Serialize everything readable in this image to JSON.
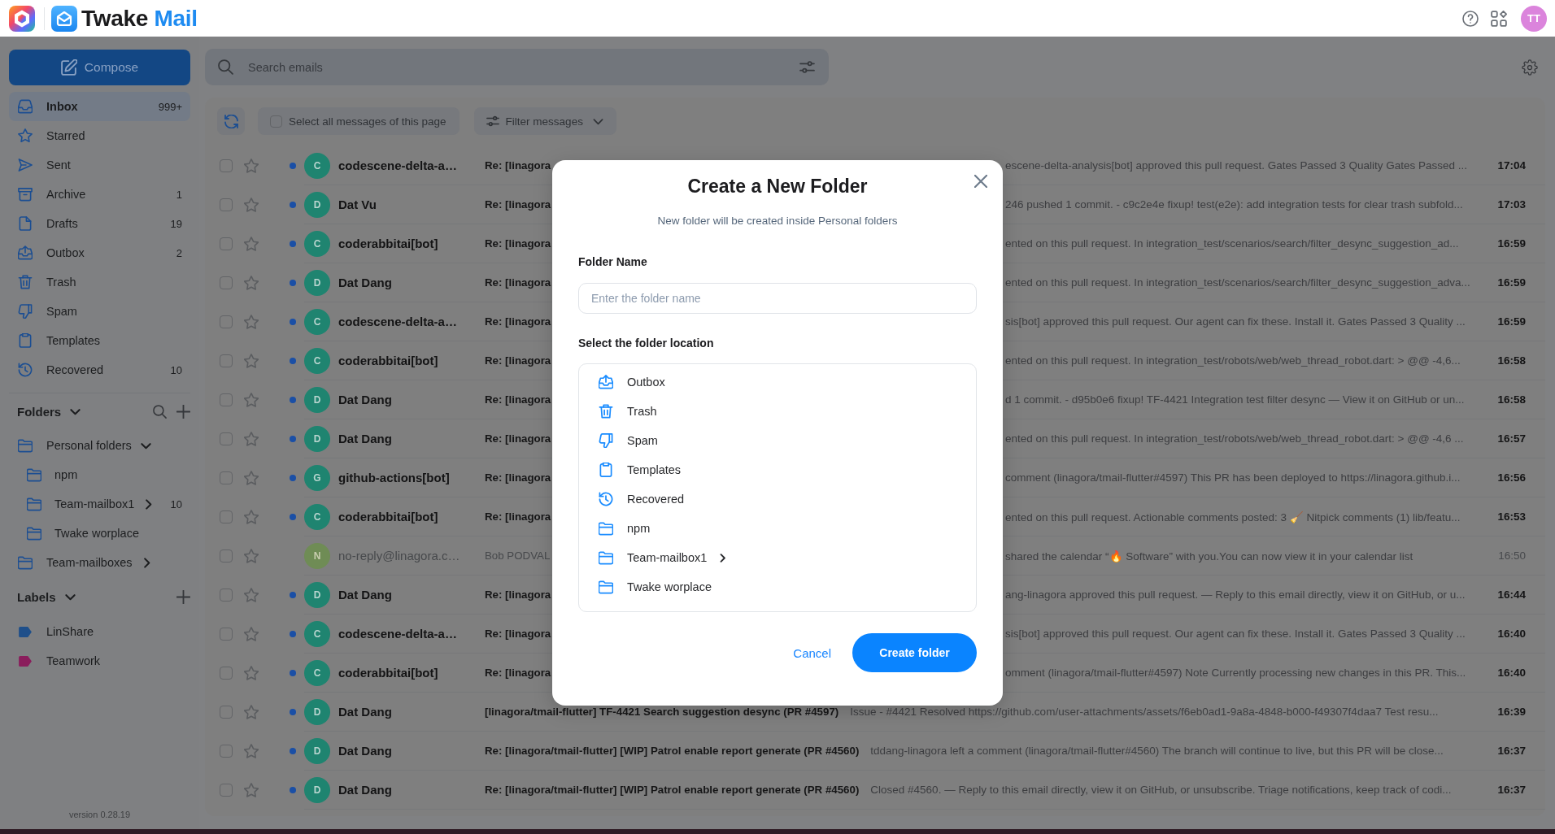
{
  "header": {
    "brand": "Twake",
    "product": "Mail",
    "user_initials": "TT"
  },
  "compose_button": "Compose",
  "mailboxes": [
    {
      "name": "Inbox",
      "kind": "inbox",
      "count": "999+",
      "selected": true
    },
    {
      "name": "Starred",
      "kind": "starred",
      "selected": false
    },
    {
      "name": "Sent",
      "kind": "sent",
      "selected": false
    },
    {
      "name": "Archive",
      "kind": "archive",
      "count": "1",
      "selected": false
    },
    {
      "name": "Drafts",
      "kind": "drafts",
      "count": "19",
      "selected": false
    },
    {
      "name": "Outbox",
      "kind": "outbox",
      "count": "2",
      "selected": false
    },
    {
      "name": "Trash",
      "kind": "trash",
      "selected": false
    },
    {
      "name": "Spam",
      "kind": "spam",
      "selected": false
    },
    {
      "name": "Templates",
      "kind": "templates",
      "selected": false
    },
    {
      "name": "Recovered",
      "kind": "recovered",
      "count": "10",
      "selected": false
    }
  ],
  "folders": {
    "title": "Folders",
    "expanded": true,
    "items": [
      {
        "name": "Personal folders",
        "expanded": true,
        "selected": false,
        "children": [
          {
            "name": "npm",
            "selected": false
          },
          {
            "name": "Team-mailbox1",
            "expanded": false,
            "count": "10",
            "selected": false
          },
          {
            "name": "Twake worplace",
            "selected": false
          }
        ]
      },
      {
        "name": "Team-mailboxes",
        "expanded": false,
        "selected": false
      }
    ]
  },
  "labels": {
    "title": "Labels",
    "expanded": true,
    "items": [
      {
        "name": "LinShare",
        "color": "#1f4f8a",
        "selected": false
      },
      {
        "name": "Teamwork",
        "color": "#8a1d5c",
        "selected": false
      }
    ]
  },
  "version": "version 0.28.19",
  "search": {
    "placeholder": "Search emails"
  },
  "toolbar": {
    "select_all": {
      "label": "Select all messages of this page",
      "checked": false
    },
    "filter": {
      "label": "Filter messages"
    }
  },
  "emails": [
    {
      "sender": "codescene-delta-a…",
      "avatar_letter": "C",
      "color": "#1f8470",
      "unread": true,
      "checked": false,
      "starred": false,
      "subject": "Re: [linagora",
      "preview": "escene-delta-analysis[bot] approved this pull request. Gates Passed 3 Quality Gates Passed ...",
      "time": "17:04"
    },
    {
      "sender": "Dat Vu",
      "avatar_letter": "D",
      "color": "#1f8470",
      "unread": true,
      "checked": false,
      "starred": false,
      "subject": "Re: [linagora",
      "preview": "246 pushed 1 commit. - c9c2e4e fixup! test(e2e): add integration tests for clear trash subfold...",
      "time": "17:03"
    },
    {
      "sender": "coderabbitai[bot]",
      "avatar_letter": "C",
      "color": "#1f8470",
      "unread": true,
      "checked": false,
      "starred": false,
      "subject": "Re: [linagora",
      "preview": "ented on this pull request. In integration_test/scenarios/search/filter_desync_suggestion_ad...",
      "time": "16:59"
    },
    {
      "sender": "Dat Dang",
      "avatar_letter": "D",
      "color": "#1f8470",
      "unread": true,
      "checked": false,
      "starred": false,
      "subject": "Re: [linagora",
      "preview": "ented on this pull request. In integration_test/scenarios/search/filter_desync_suggestion_adva...",
      "time": "16:59"
    },
    {
      "sender": "codescene-delta-a…",
      "avatar_letter": "C",
      "color": "#1f8470",
      "unread": true,
      "checked": false,
      "starred": false,
      "subject": "Re: [linagora",
      "preview": "sis[bot] approved this pull request. Our agent can fix these. Install it. Gates Passed 3 Quality ...",
      "time": "16:59"
    },
    {
      "sender": "coderabbitai[bot]",
      "avatar_letter": "C",
      "color": "#1f8470",
      "unread": true,
      "checked": false,
      "starred": false,
      "subject": "Re: [linagora",
      "preview": "ented on this pull request. In integration_test/robots/web/web_thread_robot.dart: > @@ -4,6...",
      "time": "16:58"
    },
    {
      "sender": "Dat Dang",
      "avatar_letter": "D",
      "color": "#1f8470",
      "unread": true,
      "checked": false,
      "starred": false,
      "subject": "Re: [linagora",
      "preview": "d 1 commit. - d95b0e6 fixup! TF-4421 Integration test filter desync — View it on GitHub or un...",
      "time": "16:58"
    },
    {
      "sender": "Dat Dang",
      "avatar_letter": "D",
      "color": "#1f8470",
      "unread": true,
      "checked": false,
      "starred": false,
      "subject": "Re: [linagora",
      "preview": "ented on this pull request. In integration_test/robots/web/web_thread_robot.dart: > @@ -4,6 ...",
      "time": "16:57"
    },
    {
      "sender": "github-actions[bot]",
      "avatar_letter": "G",
      "color": "#1f8470",
      "unread": true,
      "checked": false,
      "starred": false,
      "subject": "Re: [linagora",
      "preview": "comment (linagora/tmail-flutter#4597) This PR has been deployed to https://linagora.github.i...",
      "time": "16:56"
    },
    {
      "sender": "coderabbitai[bot]",
      "avatar_letter": "C",
      "color": "#1f8470",
      "unread": true,
      "checked": false,
      "starred": false,
      "subject": "Re: [linagora",
      "preview": "ented on this pull request. Actionable comments posted: 3 🧹 Nitpick comments (1) lib/featu...",
      "time": "16:53"
    },
    {
      "sender": "no-reply@linagora.c…",
      "avatar_letter": "N",
      "color": "#6f8c55",
      "unread": false,
      "checked": false,
      "starred": false,
      "subject": "Bob PODVAL",
      "preview": "shared the calendar “🔥 Software” with you.You can now view it in your calendar list",
      "time": "16:50"
    },
    {
      "sender": "Dat Dang",
      "avatar_letter": "D",
      "color": "#1f8470",
      "unread": true,
      "checked": false,
      "starred": false,
      "subject": "Re: [linagora",
      "preview": "ang-linagora approved this pull request. — Reply to this email directly, view it on GitHub, or u...",
      "time": "16:44"
    },
    {
      "sender": "codescene-delta-a…",
      "avatar_letter": "C",
      "color": "#1f8470",
      "unread": true,
      "checked": false,
      "starred": false,
      "subject": "Re: [linagora",
      "preview": "sis[bot] approved this pull request. Our agent can fix these. Install it. Gates Passed 3 Quality ...",
      "time": "16:40"
    },
    {
      "sender": "coderabbitai[bot]",
      "avatar_letter": "C",
      "color": "#1f8470",
      "unread": true,
      "checked": false,
      "starred": false,
      "subject": "Re: [linagora",
      "preview": "omment (linagora/tmail-flutter#4597) Note Currently processing new changes in this PR. This...",
      "time": "16:40"
    },
    {
      "sender": "Dat Dang",
      "avatar_letter": "D",
      "color": "#1f8470",
      "unread": true,
      "checked": false,
      "starred": false,
      "subject": "[linagora/tmail-flutter] TF-4421 Search suggestion desync (PR #4597)",
      "preview": "Issue - #4421 Resolved https://github.com/user-attachments/assets/f6eb0ad1-9a8a-4848-b000-f49307f4daa7 Test resu...",
      "time": "16:39"
    },
    {
      "sender": "Dat Dang",
      "avatar_letter": "D",
      "color": "#1f8470",
      "unread": true,
      "checked": false,
      "starred": false,
      "subject": "Re: [linagora/tmail-flutter] [WIP] Patrol enable report generate (PR #4560)",
      "preview": "tddang-linagora left a comment (linagora/tmail-flutter#4560) The branch will continue to live, but this PR will be close...",
      "time": "16:37"
    },
    {
      "sender": "Dat Dang",
      "avatar_letter": "D",
      "color": "#1f8470",
      "unread": true,
      "checked": false,
      "starred": false,
      "subject": "Re: [linagora/tmail-flutter] [WIP] Patrol enable report generate (PR #4560)",
      "preview": "Closed #4560. — Reply to this email directly, view it on GitHub, or unsubscribe. Triage notifications, keep track of codi...",
      "time": "16:37"
    }
  ],
  "dialog": {
    "title": "Create a New Folder",
    "subtitle": "New folder will be created inside Personal folders",
    "name_label": "Folder Name",
    "name_field": {
      "placeholder": "Enter the folder name"
    },
    "location_label": "Select the folder location",
    "locations": [
      {
        "name": "Outbox",
        "kind": "outbox",
        "selected": false
      },
      {
        "name": "Trash",
        "kind": "trash",
        "selected": false
      },
      {
        "name": "Spam",
        "kind": "spam",
        "selected": false
      },
      {
        "name": "Templates",
        "kind": "templates",
        "selected": false
      },
      {
        "name": "Recovered",
        "kind": "recovered",
        "selected": false
      },
      {
        "name": "npm",
        "kind": "folder",
        "selected": false
      },
      {
        "name": "Team-mailbox1",
        "kind": "folder",
        "expanded": false,
        "selected": false
      },
      {
        "name": "Twake worplace",
        "kind": "folder",
        "selected": false
      }
    ],
    "buttons": [
      {
        "label": "Cancel",
        "kind": "text"
      },
      {
        "label": "Create folder",
        "kind": "primary"
      }
    ]
  }
}
